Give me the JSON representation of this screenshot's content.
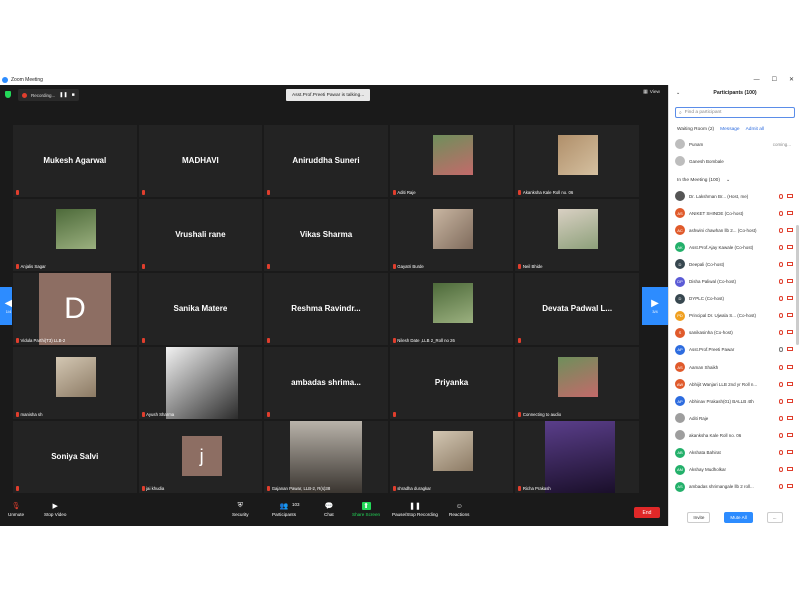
{
  "window": {
    "title": "Zoom Meeting"
  },
  "topbar": {
    "recording_label": "Recording...",
    "talking": "Asst.Prof.Preeti Pawar is talking...",
    "view_label": "View"
  },
  "grid": {
    "tiles": [
      {
        "name": "Mukesh Agarwal",
        "label": "",
        "kind": "name"
      },
      {
        "name": "MADHAVI",
        "label": "",
        "kind": "name"
      },
      {
        "name": "Aniruddha Suneri",
        "label": "",
        "kind": "name"
      },
      {
        "name": "",
        "label": "Aditi Raje",
        "kind": "photo"
      },
      {
        "name": "",
        "label": "Akanksha Kale Roll no. 06",
        "kind": "photo"
      },
      {
        "name": "",
        "label": "Anjalis Sagar",
        "kind": "photo"
      },
      {
        "name": "Vrushali rane",
        "label": "",
        "kind": "name"
      },
      {
        "name": "Vikas Sharma",
        "label": "",
        "kind": "name"
      },
      {
        "name": "",
        "label": "Gayatri Burde",
        "kind": "photo"
      },
      {
        "name": "",
        "label": "Neil Bhide",
        "kind": "photo"
      },
      {
        "name": "D",
        "label": "Vidula Parthi(T3) LLB-2",
        "kind": "avatar"
      },
      {
        "name": "Sanika Matere",
        "label": "",
        "kind": "name"
      },
      {
        "name": "Reshma  Ravindr...",
        "label": "",
        "kind": "name"
      },
      {
        "name": "",
        "label": "Nilesh Date ,LLB 2_Roll no 26",
        "kind": "photo"
      },
      {
        "name": "Devata Padwal L...",
        "label": "",
        "kind": "name"
      },
      {
        "name": "",
        "label": "manisha sh",
        "kind": "photo"
      },
      {
        "name": "",
        "label": "Ayush Sharma",
        "kind": "photo"
      },
      {
        "name": "ambadas shrima...",
        "label": "",
        "kind": "name"
      },
      {
        "name": "Priyanka",
        "label": "",
        "kind": "name"
      },
      {
        "name": "",
        "label": "Connecting to audio",
        "kind": "photo"
      },
      {
        "name": "Soniya Salvi",
        "label": "",
        "kind": "name"
      },
      {
        "name": "j",
        "label": "jai khudia",
        "kind": "avatar"
      },
      {
        "name": "",
        "label": "Gajanan Pawar, LLB-2, R(s)38",
        "kind": "photo"
      },
      {
        "name": "",
        "label": "shradha duragkar",
        "kind": "photo"
      },
      {
        "name": "",
        "label": "Richa Prakash",
        "kind": "photo"
      }
    ]
  },
  "pager": {
    "left_page": "1/4",
    "right_page": "3/4"
  },
  "toolbar": {
    "unmute": "Unmute",
    "stop_video": "Stop Video",
    "security": "Security",
    "participants": "Participants",
    "participants_count": "103",
    "chat": "Chat",
    "share_screen": "Share Screen",
    "pause_recording": "Pause/Stop Recording",
    "reactions": "Reactions",
    "end": "End"
  },
  "panel": {
    "title": "Participants (100)",
    "search_placeholder": "Find a participant",
    "waiting_room": "Waiting Room (2)",
    "message": "Message",
    "admit_all": "Admit all",
    "in_meeting": "In the Meeting (100)",
    "waiting": [
      {
        "name": "Punam",
        "status": "coming...",
        "color": "#bdbdbd",
        "init": ""
      },
      {
        "name": "Ganesh Bombale",
        "status": "",
        "color": "#bdbdbd",
        "init": ""
      }
    ],
    "participants": [
      {
        "name": "Dr. Lakshman Br... (Host, me)",
        "init": "",
        "color": "#555555"
      },
      {
        "name": "ANIKET SHINDE (Co-host)",
        "init": "AS",
        "color": "#e05a2b"
      },
      {
        "name": "ashwini chawhan llb 2... (Co-host)",
        "init": "AC",
        "color": "#e05a2b"
      },
      {
        "name": "Asst.Prof.Ajay Kawale (Co-host)",
        "init": "AK",
        "color": "#23b06a"
      },
      {
        "name": "Deepali (Co-host)",
        "init": "D",
        "color": "#37474f"
      },
      {
        "name": "Disha Paliwal (Co-host)",
        "init": "DP",
        "color": "#5b5bd6"
      },
      {
        "name": "DYPLC (Co-host)",
        "init": "D",
        "color": "#37474f"
      },
      {
        "name": "Principal Dr. Ujwala S... (Co-host)",
        "init": "PD",
        "color": "#f0a020"
      },
      {
        "name": "sanikasinha (Co-host)",
        "init": "S",
        "color": "#e05a2b"
      },
      {
        "name": "Asst.Prof.Preeti Pawar",
        "init": "AP",
        "color": "#2d6cdf"
      },
      {
        "name": "Aaman Shaikh",
        "init": "AS",
        "color": "#e05a2b"
      },
      {
        "name": "Abhijit Wanjari LLB 2nd yr Roll n...",
        "init": "AW",
        "color": "#e05a2b"
      },
      {
        "name": "Abhinav Prakash(01) BALLB 4th",
        "init": "AP",
        "color": "#2d6cdf"
      },
      {
        "name": "Aditi Raje",
        "init": "",
        "color": "#9e9e9e"
      },
      {
        "name": "akanksha Kale Roll no. 06",
        "init": "",
        "color": "#9e9e9e"
      },
      {
        "name": "Akshata Bahirat",
        "init": "AB",
        "color": "#23b06a"
      },
      {
        "name": "Akshay Mudholkar",
        "init": "AM",
        "color": "#23b06a"
      },
      {
        "name": "ambadas shrimangale llb 2 roll...",
        "init": "AS",
        "color": "#23b06a"
      }
    ],
    "invite": "Invite",
    "mute_all": "Mute All",
    "more": "..."
  }
}
